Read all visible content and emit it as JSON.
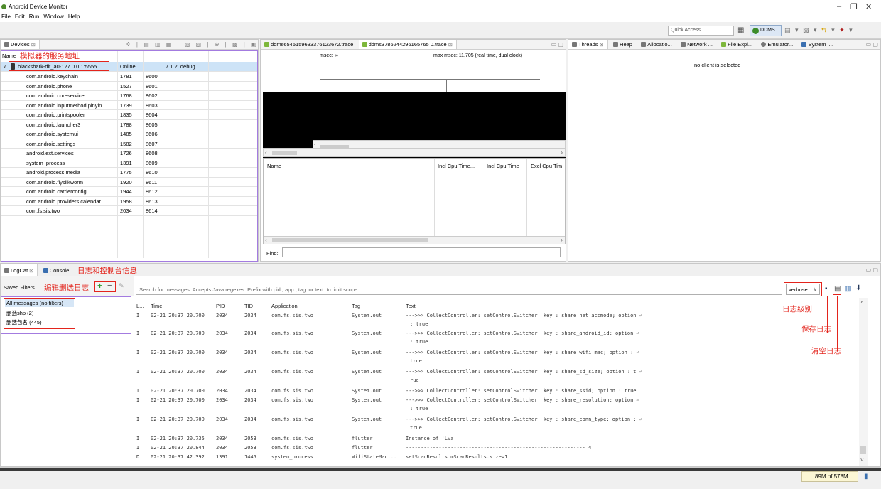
{
  "window": {
    "title": "Android Device Monitor",
    "minimize": "–",
    "maximize": "❐",
    "close": "✕"
  },
  "menu": [
    "File",
    "Edit",
    "Run",
    "Window",
    "Help"
  ],
  "toolbar": {
    "quick_access": "Quick Access",
    "perspective": "DDMS"
  },
  "devices": {
    "tab_label": "Devices",
    "header_name": "Name",
    "header_annotation": "模拟器的服务地址",
    "device": {
      "name": "blackshark-dlt_a0-127.0.0.1:5555",
      "status": "Online",
      "version": "7.1.2, debug"
    },
    "processes": [
      {
        "name": "com.android.keychain",
        "pid": "1781",
        "port": "8600"
      },
      {
        "name": "com.android.phone",
        "pid": "1527",
        "port": "8601"
      },
      {
        "name": "com.android.coreservice",
        "pid": "1768",
        "port": "8602"
      },
      {
        "name": "com.android.inputmethod.pinyin",
        "pid": "1739",
        "port": "8603"
      },
      {
        "name": "com.android.printspooler",
        "pid": "1835",
        "port": "8604"
      },
      {
        "name": "com.android.launcher3",
        "pid": "1788",
        "port": "8605"
      },
      {
        "name": "com.android.systemui",
        "pid": "1485",
        "port": "8606"
      },
      {
        "name": "com.android.settings",
        "pid": "1582",
        "port": "8607"
      },
      {
        "name": "android.ext.services",
        "pid": "1726",
        "port": "8608"
      },
      {
        "name": "system_process",
        "pid": "1391",
        "port": "8609"
      },
      {
        "name": "android.process.media",
        "pid": "1775",
        "port": "8610"
      },
      {
        "name": "com.android.flysilkworm",
        "pid": "1920",
        "port": "8611"
      },
      {
        "name": "com.android.carrierconfig",
        "pid": "1944",
        "port": "8612"
      },
      {
        "name": "com.android.providers.calendar",
        "pid": "1958",
        "port": "8613"
      },
      {
        "name": "com.fs.sis.two",
        "pid": "2034",
        "port": "8614"
      }
    ]
  },
  "trace": {
    "tab1": "ddms6545159633376123672.trace",
    "tab2": "ddms3786244296165765 0.trace",
    "msec": "msec: ∞",
    "max_msec": "max msec: 11.705 (real time, dual clock)",
    "col_name": "Name",
    "col_incl_cpu_pct": "Incl Cpu Time...",
    "col_incl_cpu": "Incl Cpu Time",
    "col_excl_cpu": "Excl Cpu Tim",
    "find_label": "Find:"
  },
  "right_tabs": [
    "Threads",
    "Heap",
    "Allocatio...",
    "Network ...",
    "File Expl...",
    "Emulator...",
    "System I..."
  ],
  "right_message": "no client is selected",
  "logcat": {
    "tab_logcat": "LogCat",
    "tab_console": "Console",
    "tabs_annotation": "日志和控制台信息",
    "saved_filters": "Saved Filters",
    "filters_annotation": "编辑删选日志",
    "filters": [
      "All messages (no filters)",
      "删选shp (2)",
      "删选包名 (445)"
    ],
    "search_placeholder": "Search for messages. Accepts Java regexes. Prefix with pid:, app:, tag: or text: to limit scope.",
    "level": "verbose",
    "level_annotation": "日志级别",
    "save_annotation": "保存日志",
    "clear_annotation": "清空日志",
    "headers": {
      "level": "L...",
      "time": "Time",
      "pid": "PID",
      "tid": "TID",
      "app": "Application",
      "tag": "Tag",
      "text": "Text"
    },
    "rows": [
      {
        "l": "I",
        "time": "02-21 20:37:20.700",
        "pid": "2034",
        "tid": "2034",
        "app": "com.fs.sis.two",
        "tag": "System.out",
        "text": "--->>> CollectController: setControlSwitcher: key : share_net_accmode; option ⏎",
        "cont": ": true"
      },
      {
        "l": "I",
        "time": "02-21 20:37:20.700",
        "pid": "2034",
        "tid": "2034",
        "app": "com.fs.sis.two",
        "tag": "System.out",
        "text": "--->>> CollectController: setControlSwitcher: key : share_android_id; option  ⏎",
        "cont": ": true"
      },
      {
        "l": "I",
        "time": "02-21 20:37:20.700",
        "pid": "2034",
        "tid": "2034",
        "app": "com.fs.sis.two",
        "tag": "System.out",
        "text": "--->>> CollectController: setControlSwitcher: key : share_wifi_mac; option : ⏎",
        "cont": "true"
      },
      {
        "l": "I",
        "time": "02-21 20:37:20.700",
        "pid": "2034",
        "tid": "2034",
        "app": "com.fs.sis.two",
        "tag": "System.out",
        "text": "--->>> CollectController: setControlSwitcher: key : share_sd_size; option : t ⏎",
        "cont": "rue"
      },
      {
        "l": "I",
        "time": "02-21 20:37:20.700",
        "pid": "2034",
        "tid": "2034",
        "app": "com.fs.sis.two",
        "tag": "System.out",
        "text": "--->>> CollectController: setControlSwitcher: key : share_ssid; option : true",
        "cont": ""
      },
      {
        "l": "I",
        "time": "02-21 20:37:20.700",
        "pid": "2034",
        "tid": "2034",
        "app": "com.fs.sis.two",
        "tag": "System.out",
        "text": "--->>> CollectController: setControlSwitcher: key : share_resolution; option ⏎",
        "cont": ": true"
      },
      {
        "l": "I",
        "time": "02-21 20:37:20.700",
        "pid": "2034",
        "tid": "2034",
        "app": "com.fs.sis.two",
        "tag": "System.out",
        "text": "--->>> CollectController: setControlSwitcher: key : share_conn_type; option : ⏎",
        "cont": "true"
      },
      {
        "l": "I",
        "time": "02-21 20:37:20.735",
        "pid": "2034",
        "tid": "2053",
        "app": "com.fs.sis.two",
        "tag": "flutter",
        "text": "Instance of 'Lva'",
        "cont": ""
      },
      {
        "l": "I",
        "time": "02-21 20:37:20.844",
        "pid": "2034",
        "tid": "2053",
        "app": "com.fs.sis.two",
        "tag": "flutter",
        "text": "------------------------------------------------------------ 4",
        "cont": ""
      },
      {
        "l": "D",
        "time": "02-21 20:37:42.392",
        "pid": "1391",
        "tid": "1445",
        "app": "system_process",
        "tag": "WifiStateMac...",
        "text": "setScanResults mScanResults.size=1",
        "cont": ""
      }
    ]
  },
  "status": {
    "memory": "89M of 578M"
  }
}
